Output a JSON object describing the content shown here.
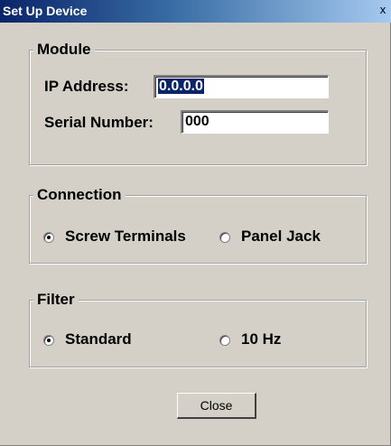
{
  "window": {
    "title": "Set Up Device",
    "close_glyph": "x"
  },
  "module": {
    "legend": "Module",
    "ip_label": "IP Address:",
    "ip_value": "0.0.0.0",
    "serial_label": "Serial Number:",
    "serial_value": "000"
  },
  "connection": {
    "legend": "Connection",
    "options": [
      {
        "label": "Screw Terminals",
        "selected": true
      },
      {
        "label": "Panel Jack",
        "selected": false
      }
    ]
  },
  "filter": {
    "legend": "Filter",
    "options": [
      {
        "label": "Standard",
        "selected": true
      },
      {
        "label": "10 Hz",
        "selected": false
      }
    ]
  },
  "buttons": {
    "close_label": "Close"
  }
}
